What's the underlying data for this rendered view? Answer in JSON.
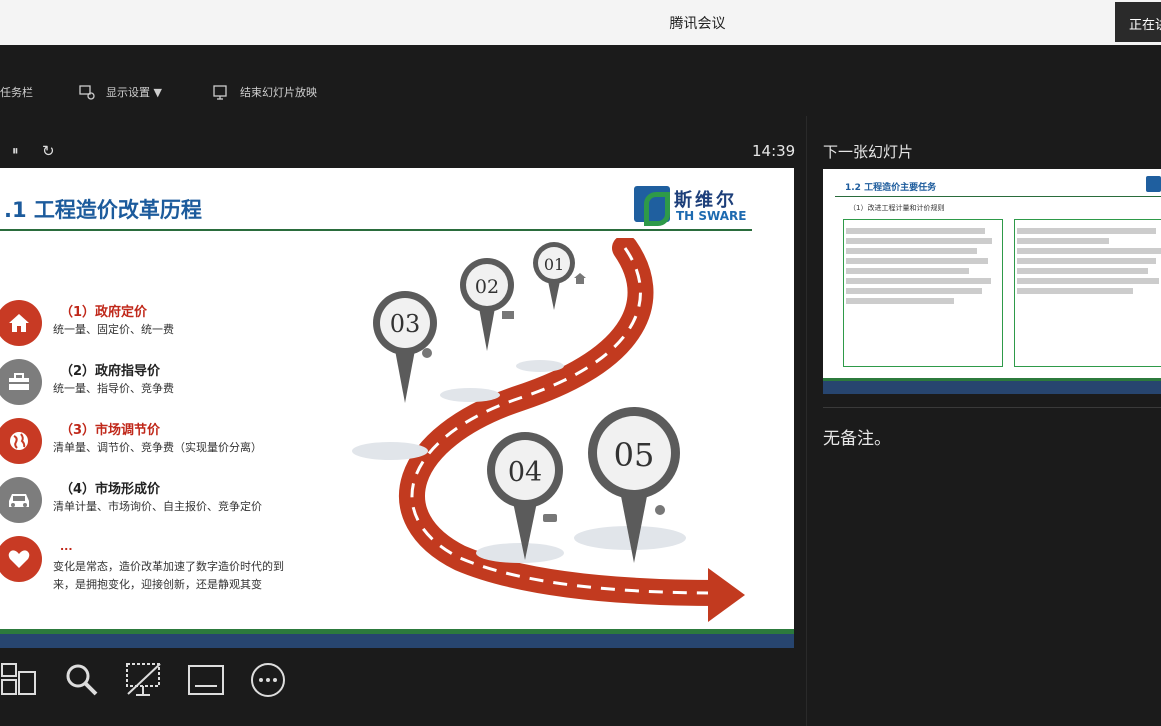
{
  "window": {
    "title": "腾讯会议",
    "status_button": "正在讲话"
  },
  "toolbar": {
    "taskbar": "任务栏",
    "display_settings": "显示设置 ▼",
    "end_slideshow": "结束幻灯片放映"
  },
  "presenter": {
    "timer": "14:39",
    "pause_glyph": "⏸",
    "reload_glyph": "↻"
  },
  "slide": {
    "title": ".1  工程造价改革历程",
    "logo_cn": "斯维尔",
    "logo_en": "TH SWARE",
    "items": [
      {
        "title": "（1）政府定价",
        "desc": "统一量、固定价、统一费",
        "icon": "house-icon",
        "title_color": "red"
      },
      {
        "title": "（2）政府指导价",
        "desc": "统一量、指导价、竞争费",
        "icon": "briefcase-icon",
        "title_color": "dark"
      },
      {
        "title": "（3）市场调节价",
        "desc": "清单量、调节价、竞争费（实现量价分离）",
        "icon": "globe-icon",
        "title_color": "red"
      },
      {
        "title": "（4）市场形成价",
        "desc": "清单计量、市场询价、自主报价、竞争定价",
        "icon": "car-icon",
        "title_color": "dark"
      }
    ],
    "closing": {
      "dots": "...",
      "line1": "变化是常态，造价改革加速了数字造价时代的到",
      "line2": "来，是拥抱变化，迎接创新，还是静观其变",
      "icon": "heart-icon"
    },
    "pins": [
      "01",
      "02",
      "03",
      "04",
      "05"
    ]
  },
  "next_slide": {
    "label": "下一张幻灯片",
    "title": "1.2  工程造价主要任务",
    "subtitle": "（1）改进工程计量和计价规则"
  },
  "notes": {
    "text": "无备注。"
  },
  "colors": {
    "accent_red": "#c83a24",
    "title_blue": "#1c5b9c",
    "band_green": "#2c7a3c",
    "band_navy": "#27456f"
  }
}
